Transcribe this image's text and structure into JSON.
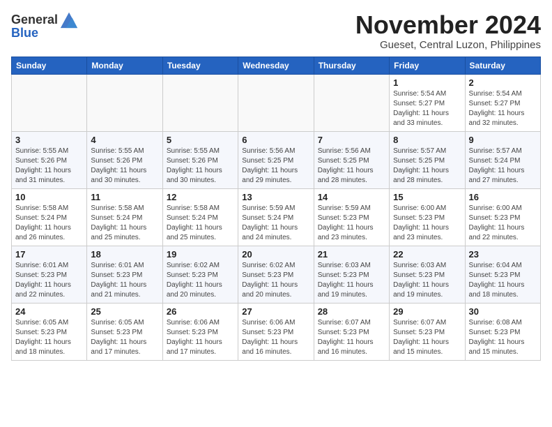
{
  "header": {
    "logo_general": "General",
    "logo_blue": "Blue",
    "month_title": "November 2024",
    "location": "Gueset, Central Luzon, Philippines"
  },
  "weekdays": [
    "Sunday",
    "Monday",
    "Tuesday",
    "Wednesday",
    "Thursday",
    "Friday",
    "Saturday"
  ],
  "weeks": [
    [
      {
        "day": "",
        "detail": ""
      },
      {
        "day": "",
        "detail": ""
      },
      {
        "day": "",
        "detail": ""
      },
      {
        "day": "",
        "detail": ""
      },
      {
        "day": "",
        "detail": ""
      },
      {
        "day": "1",
        "detail": "Sunrise: 5:54 AM\nSunset: 5:27 PM\nDaylight: 11 hours\nand 33 minutes."
      },
      {
        "day": "2",
        "detail": "Sunrise: 5:54 AM\nSunset: 5:27 PM\nDaylight: 11 hours\nand 32 minutes."
      }
    ],
    [
      {
        "day": "3",
        "detail": "Sunrise: 5:55 AM\nSunset: 5:26 PM\nDaylight: 11 hours\nand 31 minutes."
      },
      {
        "day": "4",
        "detail": "Sunrise: 5:55 AM\nSunset: 5:26 PM\nDaylight: 11 hours\nand 30 minutes."
      },
      {
        "day": "5",
        "detail": "Sunrise: 5:55 AM\nSunset: 5:26 PM\nDaylight: 11 hours\nand 30 minutes."
      },
      {
        "day": "6",
        "detail": "Sunrise: 5:56 AM\nSunset: 5:25 PM\nDaylight: 11 hours\nand 29 minutes."
      },
      {
        "day": "7",
        "detail": "Sunrise: 5:56 AM\nSunset: 5:25 PM\nDaylight: 11 hours\nand 28 minutes."
      },
      {
        "day": "8",
        "detail": "Sunrise: 5:57 AM\nSunset: 5:25 PM\nDaylight: 11 hours\nand 28 minutes."
      },
      {
        "day": "9",
        "detail": "Sunrise: 5:57 AM\nSunset: 5:24 PM\nDaylight: 11 hours\nand 27 minutes."
      }
    ],
    [
      {
        "day": "10",
        "detail": "Sunrise: 5:58 AM\nSunset: 5:24 PM\nDaylight: 11 hours\nand 26 minutes."
      },
      {
        "day": "11",
        "detail": "Sunrise: 5:58 AM\nSunset: 5:24 PM\nDaylight: 11 hours\nand 25 minutes."
      },
      {
        "day": "12",
        "detail": "Sunrise: 5:58 AM\nSunset: 5:24 PM\nDaylight: 11 hours\nand 25 minutes."
      },
      {
        "day": "13",
        "detail": "Sunrise: 5:59 AM\nSunset: 5:24 PM\nDaylight: 11 hours\nand 24 minutes."
      },
      {
        "day": "14",
        "detail": "Sunrise: 5:59 AM\nSunset: 5:23 PM\nDaylight: 11 hours\nand 23 minutes."
      },
      {
        "day": "15",
        "detail": "Sunrise: 6:00 AM\nSunset: 5:23 PM\nDaylight: 11 hours\nand 23 minutes."
      },
      {
        "day": "16",
        "detail": "Sunrise: 6:00 AM\nSunset: 5:23 PM\nDaylight: 11 hours\nand 22 minutes."
      }
    ],
    [
      {
        "day": "17",
        "detail": "Sunrise: 6:01 AM\nSunset: 5:23 PM\nDaylight: 11 hours\nand 22 minutes."
      },
      {
        "day": "18",
        "detail": "Sunrise: 6:01 AM\nSunset: 5:23 PM\nDaylight: 11 hours\nand 21 minutes."
      },
      {
        "day": "19",
        "detail": "Sunrise: 6:02 AM\nSunset: 5:23 PM\nDaylight: 11 hours\nand 20 minutes."
      },
      {
        "day": "20",
        "detail": "Sunrise: 6:02 AM\nSunset: 5:23 PM\nDaylight: 11 hours\nand 20 minutes."
      },
      {
        "day": "21",
        "detail": "Sunrise: 6:03 AM\nSunset: 5:23 PM\nDaylight: 11 hours\nand 19 minutes."
      },
      {
        "day": "22",
        "detail": "Sunrise: 6:03 AM\nSunset: 5:23 PM\nDaylight: 11 hours\nand 19 minutes."
      },
      {
        "day": "23",
        "detail": "Sunrise: 6:04 AM\nSunset: 5:23 PM\nDaylight: 11 hours\nand 18 minutes."
      }
    ],
    [
      {
        "day": "24",
        "detail": "Sunrise: 6:05 AM\nSunset: 5:23 PM\nDaylight: 11 hours\nand 18 minutes."
      },
      {
        "day": "25",
        "detail": "Sunrise: 6:05 AM\nSunset: 5:23 PM\nDaylight: 11 hours\nand 17 minutes."
      },
      {
        "day": "26",
        "detail": "Sunrise: 6:06 AM\nSunset: 5:23 PM\nDaylight: 11 hours\nand 17 minutes."
      },
      {
        "day": "27",
        "detail": "Sunrise: 6:06 AM\nSunset: 5:23 PM\nDaylight: 11 hours\nand 16 minutes."
      },
      {
        "day": "28",
        "detail": "Sunrise: 6:07 AM\nSunset: 5:23 PM\nDaylight: 11 hours\nand 16 minutes."
      },
      {
        "day": "29",
        "detail": "Sunrise: 6:07 AM\nSunset: 5:23 PM\nDaylight: 11 hours\nand 15 minutes."
      },
      {
        "day": "30",
        "detail": "Sunrise: 6:08 AM\nSunset: 5:23 PM\nDaylight: 11 hours\nand 15 minutes."
      }
    ]
  ]
}
